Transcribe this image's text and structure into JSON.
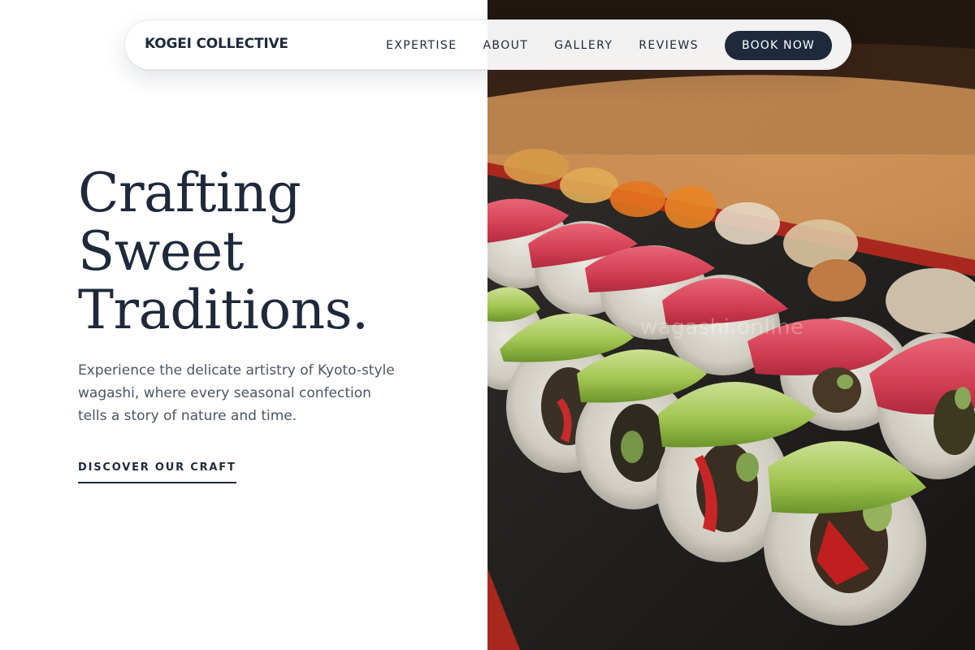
{
  "nav": {
    "brand": "KOGEI COLLECTIVE",
    "links": [
      "EXPERTISE",
      "ABOUT",
      "GALLERY",
      "REVIEWS"
    ],
    "cta": "BOOK NOW"
  },
  "hero": {
    "title_lines": [
      "Crafting",
      "Sweet",
      "Traditions."
    ],
    "description": "Experience the delicate artistry of Kyoto-style wagashi, where every seasonal confection tells a story of nature and time.",
    "cta": "DISCOVER OUR CRAFT"
  },
  "image": {
    "watermark": "wagashi.online",
    "subject": "sushi-rolls-photo"
  },
  "colors": {
    "text_dark": "#1e293b",
    "text_body": "#4b5563",
    "button_bg": "#1e293b",
    "background": "#ffffff"
  }
}
